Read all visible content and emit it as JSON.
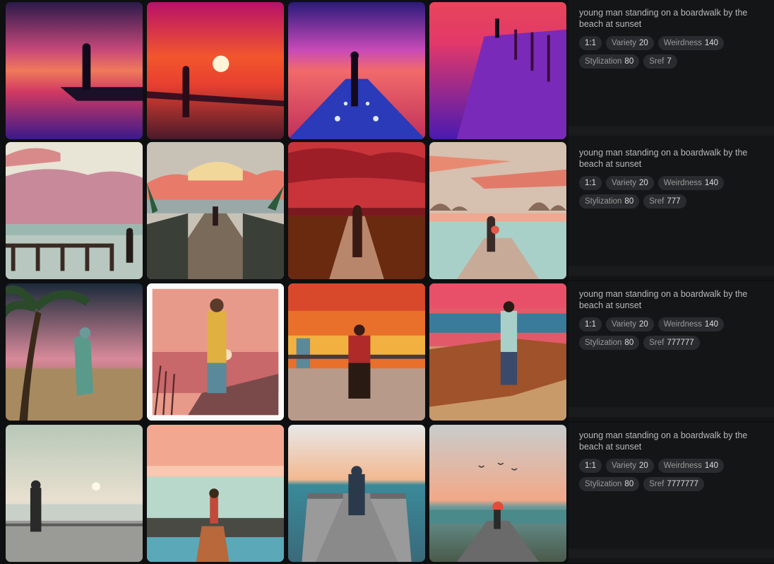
{
  "rows": [
    {
      "prompt": "young man standing on a boardwalk by the beach at sunset",
      "chips": [
        {
          "key": "",
          "value": "1:1"
        },
        {
          "key": "Variety",
          "value": "20"
        },
        {
          "key": "Weirdness",
          "value": "140"
        },
        {
          "key": "Stylization",
          "value": "80"
        },
        {
          "key": "Sref",
          "value": "7"
        }
      ]
    },
    {
      "prompt": "young man standing on a boardwalk by the beach at sunset",
      "chips": [
        {
          "key": "",
          "value": "1:1"
        },
        {
          "key": "Variety",
          "value": "20"
        },
        {
          "key": "Weirdness",
          "value": "140"
        },
        {
          "key": "Stylization",
          "value": "80"
        },
        {
          "key": "Sref",
          "value": "777"
        }
      ]
    },
    {
      "prompt": "young man standing on a boardwalk by the beach at sunset",
      "chips": [
        {
          "key": "",
          "value": "1:1"
        },
        {
          "key": "Variety",
          "value": "20"
        },
        {
          "key": "Weirdness",
          "value": "140"
        },
        {
          "key": "Stylization",
          "value": "80"
        },
        {
          "key": "Sref",
          "value": "777777"
        }
      ]
    },
    {
      "prompt": "young man standing on a boardwalk by the beach at sunset",
      "chips": [
        {
          "key": "",
          "value": "1:1"
        },
        {
          "key": "Variety",
          "value": "20"
        },
        {
          "key": "Weirdness",
          "value": "140"
        },
        {
          "key": "Stylization",
          "value": "80"
        },
        {
          "key": "Sref",
          "value": "7777777"
        }
      ]
    }
  ]
}
